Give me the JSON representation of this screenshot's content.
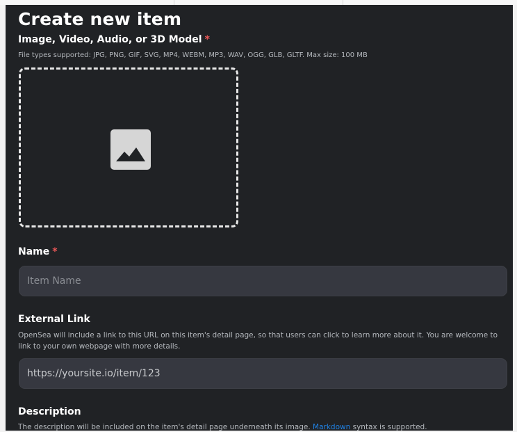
{
  "page": {
    "title": "Create new item"
  },
  "media": {
    "label": "Image, Video, Audio, or 3D Model",
    "required_mark": "*",
    "supported_types": "File types supported: JPG, PNG, GIF, SVG, MP4, WEBM, MP3, WAV, OGG, GLB, GLTF. Max size: 100 MB",
    "icon": "image-placeholder-icon"
  },
  "name": {
    "label": "Name",
    "required_mark": "*",
    "placeholder": "Item Name"
  },
  "external_link": {
    "label": "External Link",
    "description": "OpenSea will include a link to this URL on this item's detail page, so that users can click to learn more about it. You are welcome to link to your own webpage with more details.",
    "placeholder": "https://yoursite.io/item/123"
  },
  "description": {
    "label": "Description",
    "caption_before": "The description will be included on the item's detail page underneath its image. ",
    "markdown_link": "Markdown",
    "caption_after": " syntax is supported."
  },
  "colors": {
    "background": "#202225",
    "input_background": "#363840",
    "required": "#eb5757",
    "link": "#2081e2"
  }
}
